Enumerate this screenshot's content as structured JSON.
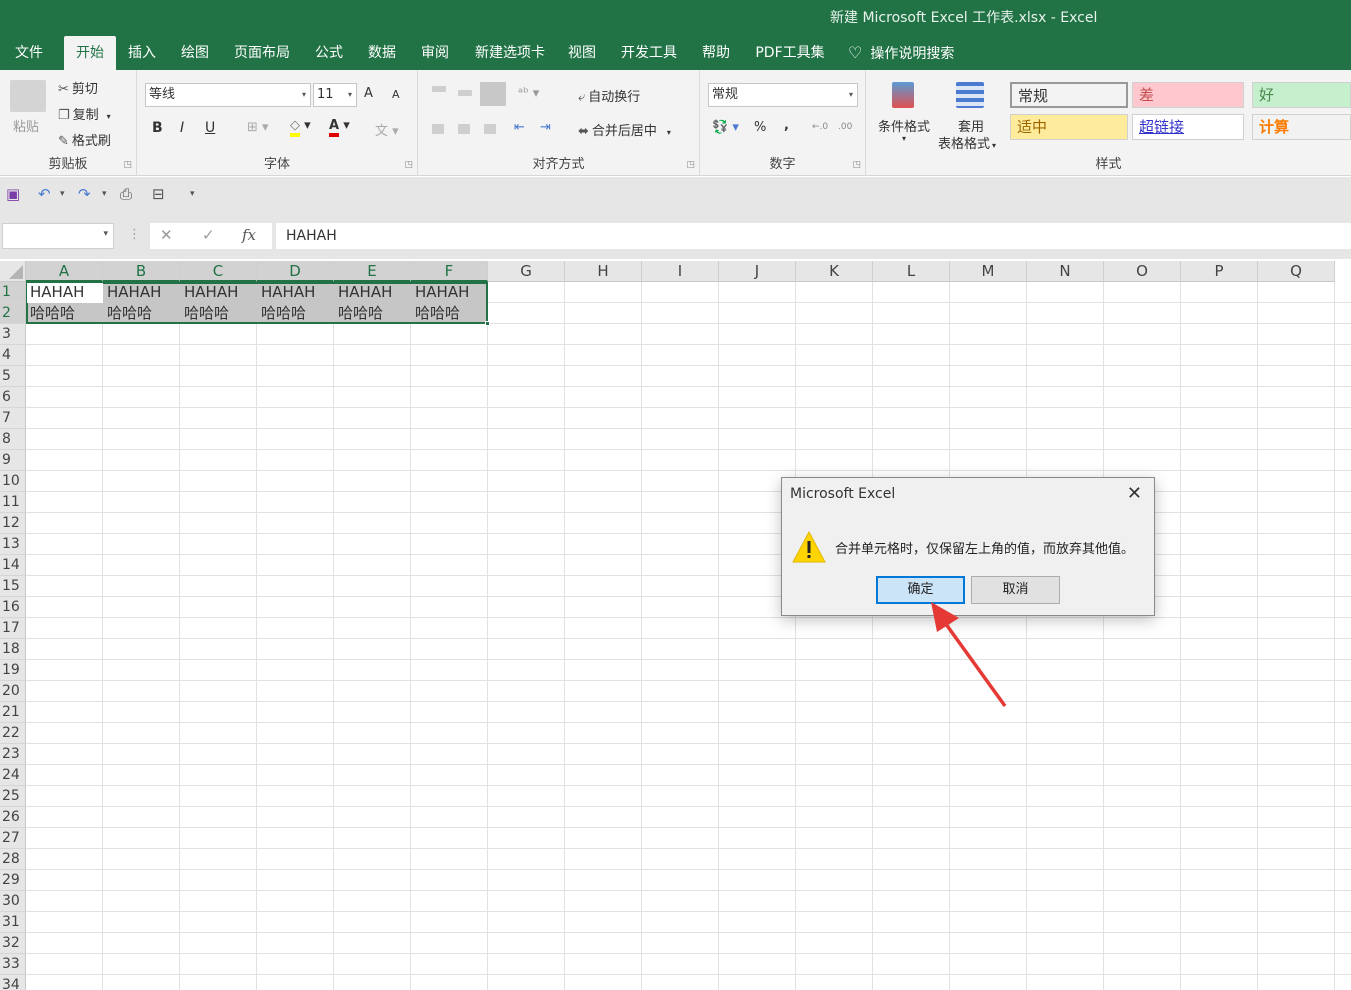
{
  "window": {
    "title": "新建 Microsoft Excel 工作表.xlsx  -  Excel"
  },
  "tabs": [
    {
      "label": "文件"
    },
    {
      "label": "开始"
    },
    {
      "label": "插入"
    },
    {
      "label": "绘图"
    },
    {
      "label": "页面布局"
    },
    {
      "label": "公式"
    },
    {
      "label": "数据"
    },
    {
      "label": "审阅"
    },
    {
      "label": "新建选项卡"
    },
    {
      "label": "视图"
    },
    {
      "label": "开发工具"
    },
    {
      "label": "帮助"
    },
    {
      "label": "PDF工具集"
    },
    {
      "label": "操作说明搜索"
    }
  ],
  "ribbon": {
    "clipboard": {
      "label": "剪贴板",
      "paste": "粘贴",
      "cut": "剪切",
      "copy": "复制",
      "format_painter": "格式刷"
    },
    "font": {
      "label": "字体",
      "font_name": "等线",
      "font_size": "11",
      "bold": "B",
      "italic": "I",
      "underline": "U",
      "grow": "A",
      "shrink": "A"
    },
    "alignment": {
      "label": "对齐方式",
      "wrap_text": "自动换行",
      "merge_center": "合并后居中"
    },
    "number": {
      "label": "数字",
      "format": "常规",
      "percent": "%",
      "comma": ","
    },
    "styles": {
      "label": "样式",
      "conditional": "条件格式",
      "table_format_1": "套用",
      "table_format_2": "表格格式",
      "cells": [
        {
          "text": "常规",
          "bg": "#ffffff",
          "fg": "#333333"
        },
        {
          "text": "差",
          "bg": "#ffc7ce",
          "fg": "#c0504d"
        },
        {
          "text": "好",
          "bg": "#c6efce",
          "fg": "#4a8a4a"
        },
        {
          "text": "适中",
          "bg": "#ffeb9c",
          "fg": "#9c6500"
        },
        {
          "text": "超链接",
          "bg": "#ffffff",
          "fg": "#3333cc"
        },
        {
          "text": "计算",
          "bg": "#f2f2f2",
          "fg": "#fa7d00"
        }
      ]
    }
  },
  "formula_bar": {
    "name_box": "",
    "fx": "fx",
    "value": "HAHAH"
  },
  "grid": {
    "columns": [
      "A",
      "B",
      "C",
      "D",
      "E",
      "F",
      "G",
      "H",
      "I",
      "J",
      "K",
      "L",
      "M",
      "N",
      "O",
      "P",
      "Q"
    ],
    "rows": [
      "1",
      "2",
      "3",
      "4",
      "5",
      "6",
      "7",
      "8",
      "9",
      "10",
      "11",
      "12",
      "13",
      "14",
      "15",
      "16",
      "17",
      "18",
      "19",
      "20",
      "21",
      "22",
      "23",
      "24",
      "25",
      "26",
      "27",
      "28",
      "29",
      "30",
      "31",
      "32",
      "33",
      "34"
    ],
    "row1": [
      "HAHAH",
      "HAHAH",
      "HAHAH",
      "HAHAH",
      "HAHAH",
      "HAHAH"
    ],
    "row2": [
      "哈哈哈",
      "哈哈哈",
      "哈哈哈",
      "哈哈哈",
      "哈哈哈",
      "哈哈哈"
    ]
  },
  "dialog": {
    "title": "Microsoft Excel",
    "message": "合并单元格时，仅保留左上角的值，而放弃其他值。",
    "ok": "确定",
    "cancel": "取消"
  },
  "colors": {
    "accent": "#217346",
    "annotation": "#e53935"
  }
}
